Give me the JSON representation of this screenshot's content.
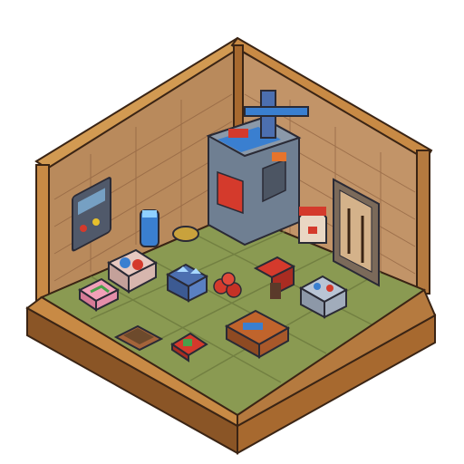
{
  "scene": {
    "type": "isometric-pixel-art-room",
    "theme": "workshop-storage-room",
    "has_text": false
  },
  "palette": {
    "background": "#ffffff",
    "frame_light": "#d29a52",
    "frame_dark": "#8a5526",
    "wall_left": "#b98a5c",
    "wall_right": "#c29468",
    "brick_line": "#8f6240",
    "floor": "#8a9a52",
    "floor_tile_line": "#6d7a3e",
    "machine_body": "#6f7f92",
    "machine_accent_red": "#d43a2c",
    "machine_accent_blue": "#3a7fd0",
    "crate_red": "#b8442c",
    "crate_blue": "#4c6fb0",
    "outline": "#3a2414"
  },
  "objects": [
    {
      "name": "generator-machine",
      "icon": "generator-icon"
    },
    {
      "name": "wall-control-panel",
      "icon": "control-panel-icon"
    },
    {
      "name": "blue-canister",
      "icon": "canister-icon"
    },
    {
      "name": "floor-button",
      "icon": "pressure-plate-icon"
    },
    {
      "name": "robot-helmet",
      "icon": "robot-helmet-icon"
    },
    {
      "name": "tool-wall-rack",
      "icon": "tool-rack-icon"
    },
    {
      "name": "supply-box-blue-items",
      "icon": "supply-box-icon"
    },
    {
      "name": "gem-crate-blue",
      "icon": "gem-crate-icon"
    },
    {
      "name": "pink-gift-box",
      "icon": "gift-box-icon"
    },
    {
      "name": "red-drill-tool",
      "icon": "drill-icon"
    },
    {
      "name": "red-fruit-pile",
      "icon": "fruit-icon"
    },
    {
      "name": "parts-crate-right",
      "icon": "parts-crate-icon"
    },
    {
      "name": "floor-tray-left",
      "icon": "tray-icon"
    },
    {
      "name": "red-gadget-small",
      "icon": "gadget-icon"
    },
    {
      "name": "tool-crate-front",
      "icon": "toolbox-icon"
    }
  ]
}
